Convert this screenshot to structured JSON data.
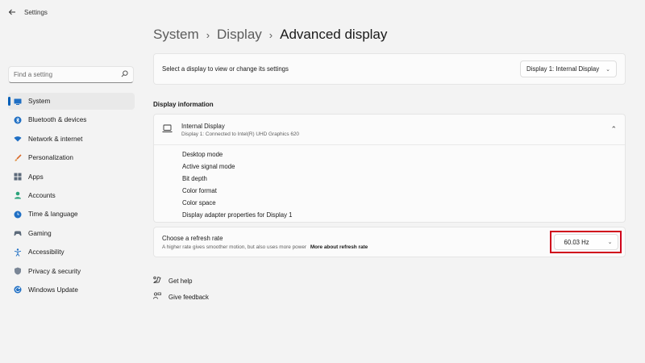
{
  "window": {
    "app_title": "Settings",
    "back_icon": "back-arrow-icon"
  },
  "sidebar": {
    "search_placeholder": "Find a setting",
    "items": [
      {
        "label": "System",
        "icon": "monitor-icon",
        "active": true
      },
      {
        "label": "Bluetooth & devices",
        "icon": "bluetooth-icon"
      },
      {
        "label": "Network & internet",
        "icon": "wifi-icon"
      },
      {
        "label": "Personalization",
        "icon": "brush-icon"
      },
      {
        "label": "Apps",
        "icon": "apps-icon"
      },
      {
        "label": "Accounts",
        "icon": "person-icon"
      },
      {
        "label": "Time & language",
        "icon": "globe-clock-icon"
      },
      {
        "label": "Gaming",
        "icon": "gamepad-icon"
      },
      {
        "label": "Accessibility",
        "icon": "accessibility-icon"
      },
      {
        "label": "Privacy & security",
        "icon": "shield-icon"
      },
      {
        "label": "Windows Update",
        "icon": "update-icon"
      }
    ]
  },
  "breadcrumb": {
    "level1": "System",
    "level2": "Display",
    "current": "Advanced display",
    "separator": "›"
  },
  "display_select": {
    "label": "Select a display to view or change its settings",
    "value": "Display 1: Internal Display"
  },
  "display_info": {
    "section_title": "Display information",
    "title": "Internal Display",
    "subtitle": "Display 1: Connected to Intel(R) UHD Graphics 620",
    "rows": [
      "Desktop mode",
      "Active signal mode",
      "Bit depth",
      "Color format",
      "Color space",
      "Display adapter properties for Display 1"
    ]
  },
  "refresh_rate": {
    "title": "Choose a refresh rate",
    "subtitle": "A higher rate gives smoother motion, but also uses more power",
    "link": "More about refresh rate",
    "value": "60.03 Hz",
    "highlight_color": "#d0021b"
  },
  "help": {
    "get_help": "Get help",
    "give_feedback": "Give feedback"
  },
  "colors": {
    "accent": "#005fb8",
    "background": "#f3f3f3",
    "card": "#fbfbfb"
  }
}
